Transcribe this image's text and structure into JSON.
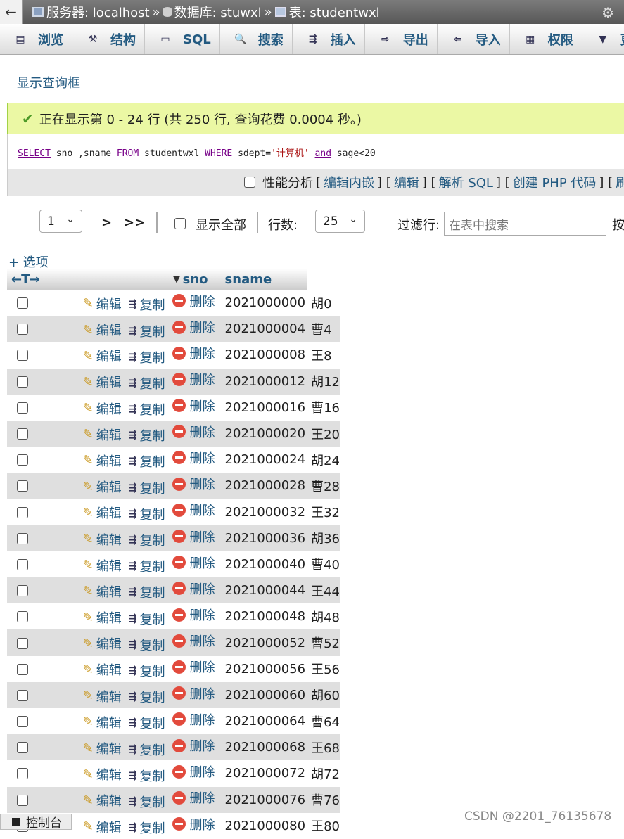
{
  "breadcrumb": {
    "server_label": "服务器: localhost",
    "database_label": "数据库: stuwxl",
    "table_label": "表: studentwxl",
    "separator": "»"
  },
  "tabs": [
    {
      "label": "浏览",
      "icon": "browse-icon"
    },
    {
      "label": "结构",
      "icon": "structure-icon"
    },
    {
      "label": "SQL",
      "icon": "sql-icon"
    },
    {
      "label": "搜索",
      "icon": "search-icon"
    },
    {
      "label": "插入",
      "icon": "insert-icon"
    },
    {
      "label": "导出",
      "icon": "export-icon"
    },
    {
      "label": "导入",
      "icon": "import-icon"
    },
    {
      "label": "权限",
      "icon": "privileges-icon"
    },
    {
      "label": "更多",
      "icon": "more-icon"
    }
  ],
  "show_query_link": "显示查询框",
  "success_message": "正在显示第 0 - 24 行 (共 250 行, 查询花费 0.0004 秒。)",
  "sql": {
    "select": "SELECT",
    "cols": " sno ,sname ",
    "from": "FROM",
    "table": " studentwxl ",
    "where": "WHERE",
    "cond1": " sdept=",
    "value": "'计算机'",
    "and": "and",
    "cond2": " sage<20"
  },
  "sql_links": {
    "profiling": "性能分析",
    "edit_inline": "编辑内嵌",
    "edit": "编辑",
    "explain": "解析 SQL",
    "create_php": "创建 PHP 代码",
    "refresh": "刷新"
  },
  "nav": {
    "page": "1",
    "next": ">",
    "last": ">>",
    "show_all": "显示全部",
    "rows_label": "行数:",
    "rows_value": "25",
    "filter_label": "过滤行:",
    "filter_placeholder": "在表中搜索",
    "sort_label": "按"
  },
  "options_link": "+ 选项",
  "columns": [
    "sno",
    "sname"
  ],
  "actions": {
    "edit": "编辑",
    "copy": "复制",
    "delete": "删除"
  },
  "rows": [
    {
      "sno": "2021000000",
      "sname": "胡0"
    },
    {
      "sno": "2021000004",
      "sname": "曹4"
    },
    {
      "sno": "2021000008",
      "sname": "王8"
    },
    {
      "sno": "2021000012",
      "sname": "胡12"
    },
    {
      "sno": "2021000016",
      "sname": "曹16"
    },
    {
      "sno": "2021000020",
      "sname": "王20"
    },
    {
      "sno": "2021000024",
      "sname": "胡24"
    },
    {
      "sno": "2021000028",
      "sname": "曹28"
    },
    {
      "sno": "2021000032",
      "sname": "王32"
    },
    {
      "sno": "2021000036",
      "sname": "胡36"
    },
    {
      "sno": "2021000040",
      "sname": "曹40"
    },
    {
      "sno": "2021000044",
      "sname": "王44"
    },
    {
      "sno": "2021000048",
      "sname": "胡48"
    },
    {
      "sno": "2021000052",
      "sname": "曹52"
    },
    {
      "sno": "2021000056",
      "sname": "王56"
    },
    {
      "sno": "2021000060",
      "sname": "胡60"
    },
    {
      "sno": "2021000064",
      "sname": "曹64"
    },
    {
      "sno": "2021000068",
      "sname": "王68"
    },
    {
      "sno": "2021000072",
      "sname": "胡72"
    },
    {
      "sno": "2021000076",
      "sname": "曹76"
    },
    {
      "sno": "2021000080",
      "sname": "王80"
    }
  ],
  "console_label": "控制台",
  "watermark": "CSDN @2201_76135678"
}
